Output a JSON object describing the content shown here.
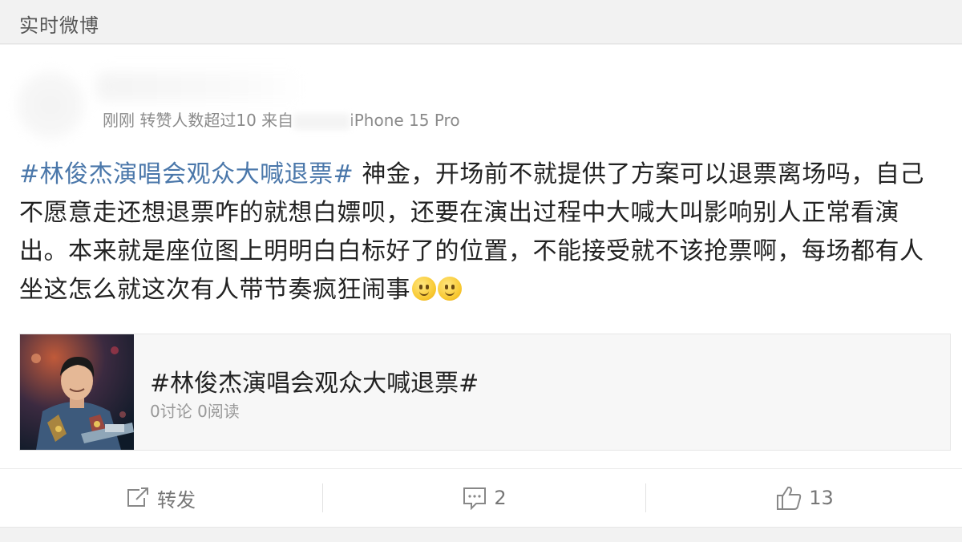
{
  "header": {
    "title": "实时微博"
  },
  "post": {
    "meta": {
      "time": "刚刚",
      "reposts_note": "转赞人数超过10",
      "source_prefix": "来自",
      "device": "iPhone 15 Pro"
    },
    "topic_tag": "#林俊杰演唱会观众大喊退票#",
    "body": " 神金，开场前不就提供了方案可以退票离场吗，自己不愿意走还想退票咋的就想白嫖呗，还要在演出过程中大喊大叫影响别人正常看演出。本来就是座位图上明明白白标好了的位置，不能接受就不该抢票啊，每场都有人坐这怎么就这次有人带节奏疯狂闹事",
    "emoji_names": [
      "smile-emoji",
      "smile-emoji"
    ]
  },
  "topic_card": {
    "title": "#林俊杰演唱会观众大喊退票#",
    "stats": "0讨论 0阅读"
  },
  "actions": {
    "repost_label": "转发",
    "comment_count": "2",
    "like_count": "13"
  },
  "colors": {
    "topic_link": "#4a77aa",
    "background": "#f2f2f2",
    "card": "#ffffff"
  }
}
